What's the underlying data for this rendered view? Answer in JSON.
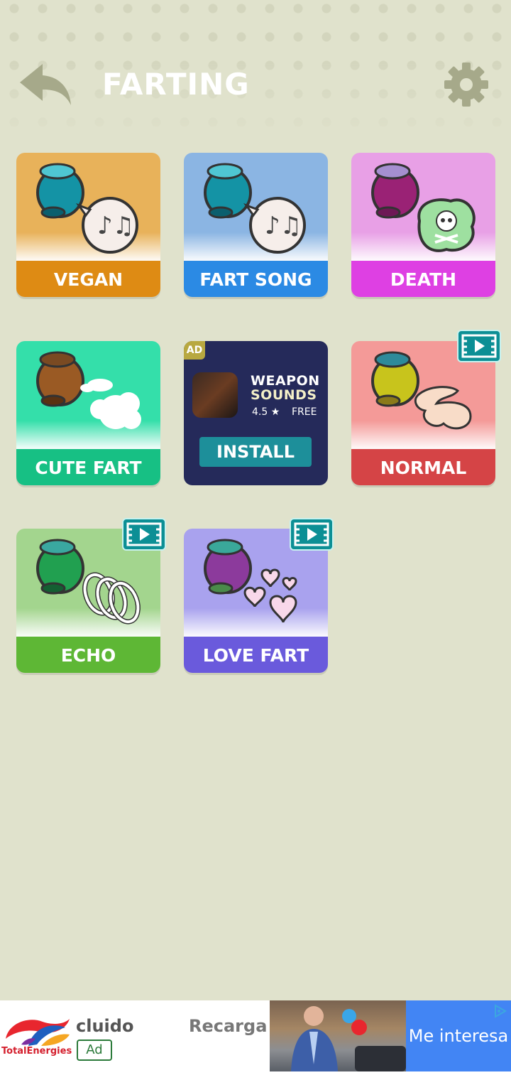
{
  "header": {
    "title": "FARTING",
    "back_icon": "back-arrow-icon",
    "settings_icon": "gear-icon"
  },
  "colors": {
    "background": "#e0e2cc",
    "vegan": "#de8b14",
    "fart_song": "#2b8ae4",
    "death": "#de40e3",
    "cute_fart": "#17c084",
    "normal": "#d54446",
    "echo": "#5eb735",
    "love_fart": "#6a5adc"
  },
  "sounds": [
    {
      "label": "VEGAN",
      "locked_by_video": false
    },
    {
      "label": "FART SONG",
      "locked_by_video": false
    },
    {
      "label": "DEATH",
      "locked_by_video": false
    },
    {
      "label": "CUTE FART",
      "locked_by_video": false
    },
    {
      "label": "NORMAL",
      "locked_by_video": true
    },
    {
      "label": "ECHO",
      "locked_by_video": true
    },
    {
      "label": "LOVE FART",
      "locked_by_video": true
    }
  ],
  "ad_card": {
    "tag": "AD",
    "app_title_line1": "WEAPON",
    "app_title_line2": "SOUNDS",
    "rating": "4.5 ★",
    "price": "FREE",
    "install_label": "INSTALL"
  },
  "banner": {
    "brand": "TotalEnergies",
    "text1": "cluido",
    "ad_label": "Ad",
    "text2": "Recarga",
    "cta": "Me interesa"
  }
}
